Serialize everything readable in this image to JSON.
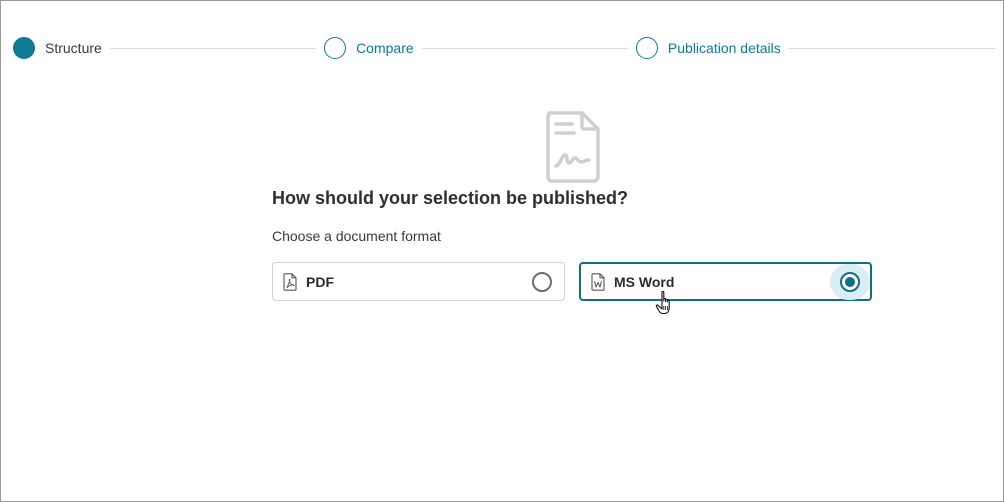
{
  "stepper": {
    "steps": [
      {
        "label": "Structure",
        "state": "active"
      },
      {
        "label": "Compare",
        "state": "pending"
      },
      {
        "label": "Publication details",
        "state": "pending"
      }
    ]
  },
  "hero": {
    "icon": "signed-document-icon"
  },
  "question": {
    "title": "How should your selection be published?",
    "subtitle": "Choose a document format"
  },
  "formats": {
    "options": [
      {
        "label": "PDF",
        "icon": "pdf-file-icon",
        "selected": false
      },
      {
        "label": "MS Word",
        "icon": "word-file-icon",
        "selected": true
      }
    ]
  },
  "colors": {
    "accent": "#0e7a93",
    "selected_border": "#0e6f86",
    "selected_radio_bg": "#dcedf1",
    "muted_icon": "#cfcfcf",
    "divider": "#dcdcdc"
  }
}
